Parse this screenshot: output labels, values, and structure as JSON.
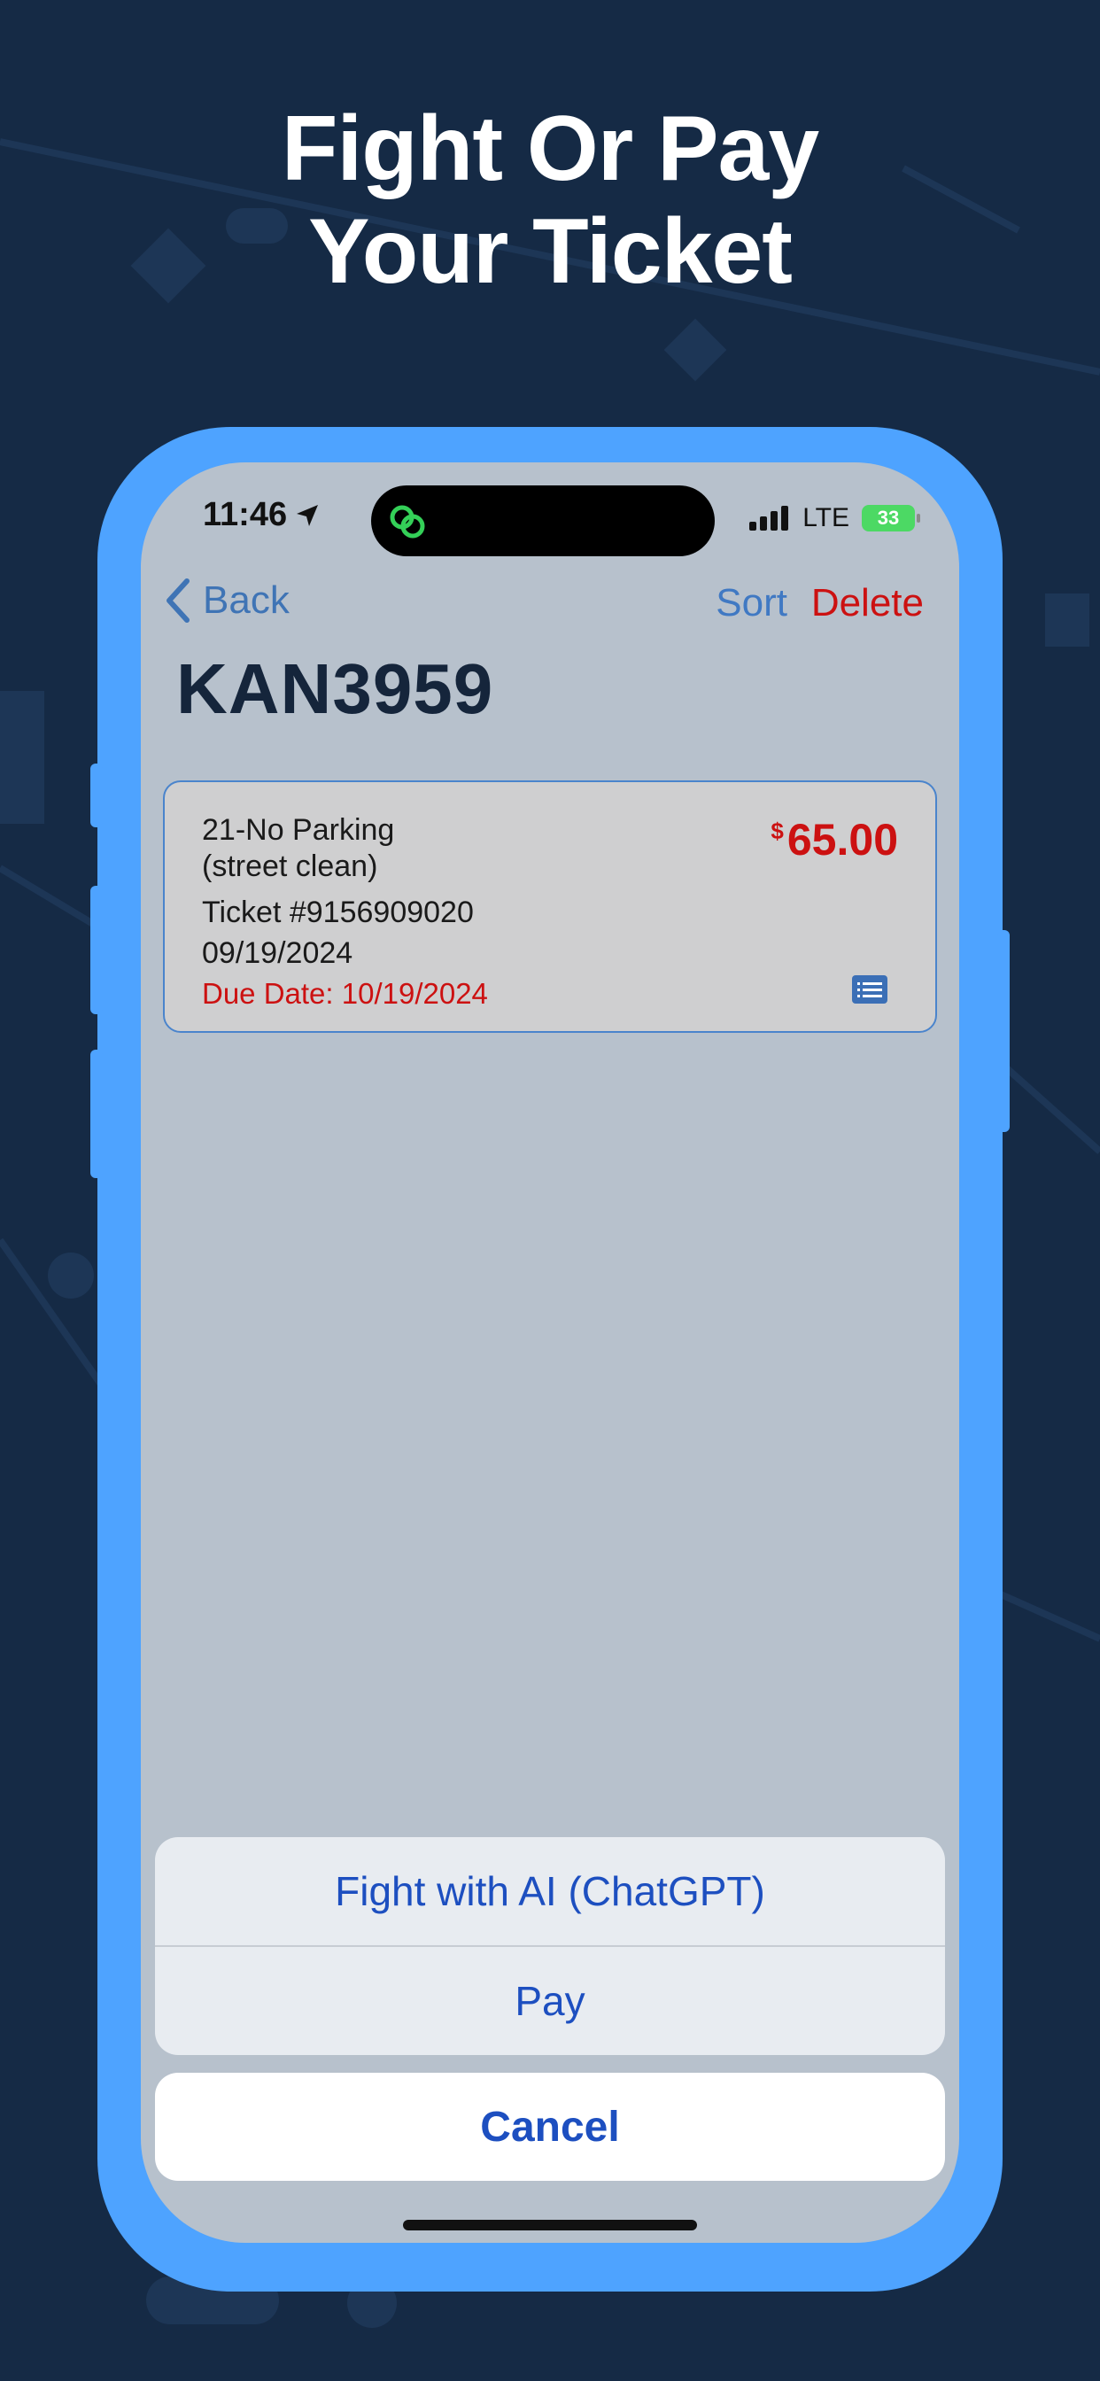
{
  "headline": {
    "line1": "Fight Or Pay",
    "line2": "Your Ticket"
  },
  "status_bar": {
    "time": "11:46",
    "network": "LTE",
    "battery": "33"
  },
  "nav": {
    "back_label": "Back",
    "sort_label": "Sort",
    "delete_label": "Delete"
  },
  "plate": "KAN3959",
  "ticket": {
    "violation_line1": "21-No Parking",
    "violation_line2": "(street clean)",
    "currency": "$",
    "amount": "65.00",
    "ticket_number": "Ticket #9156909020",
    "date": "09/19/2024",
    "due_date": "Due Date: 10/19/2024"
  },
  "action_sheet": {
    "fight_label": "Fight with AI (ChatGPT)",
    "pay_label": "Pay",
    "cancel_label": "Cancel"
  },
  "colors": {
    "background": "#152a45",
    "phone_frame": "#4ea3ff",
    "accent_red": "#cc1111",
    "accent_blue": "#1d4fc0"
  }
}
